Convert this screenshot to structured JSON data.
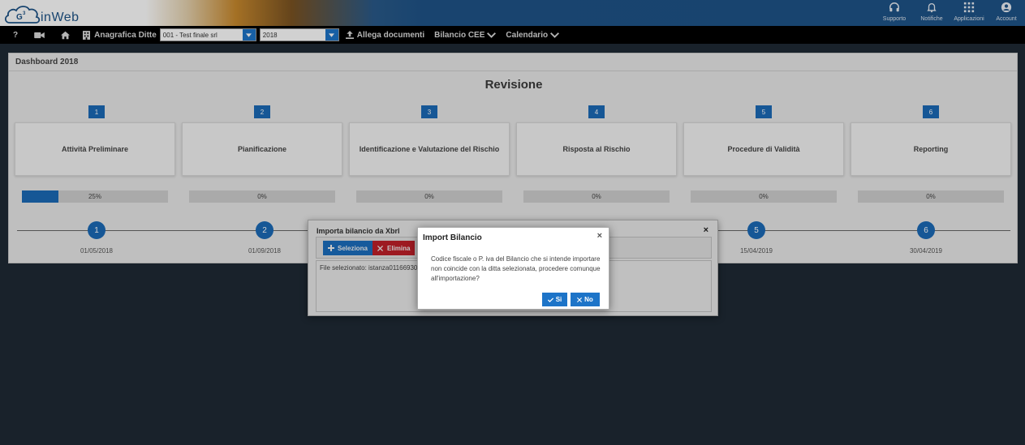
{
  "app": {
    "logo_badge": "G3",
    "logo_text": "inWeb"
  },
  "top_menu": [
    {
      "label": "Supporto",
      "icon": "headphones-icon"
    },
    {
      "label": "Notifiche",
      "icon": "bell-icon"
    },
    {
      "label": "Applicazioni",
      "icon": "grid-icon"
    },
    {
      "label": "Account",
      "icon": "user-icon"
    }
  ],
  "navbar": {
    "help": "?",
    "company_label": "Anagrafica Ditte",
    "company_value": "001 - Test finale srl",
    "year_value": "2018",
    "attach": "Allega documenti",
    "bilancio": "Bilancio CEE",
    "calendario": "Calendario"
  },
  "dashboard": {
    "header": "Dashboard 2018",
    "title": "Revisione",
    "steps": [
      {
        "num": "1",
        "label": "Attività Preliminare",
        "progress_text": "25%",
        "progress": 0.25,
        "node": "1",
        "date": "01/05/2018"
      },
      {
        "num": "2",
        "label": "Pianificazione",
        "progress_text": "0%",
        "progress": 0,
        "node": "2",
        "date": "01/09/2018"
      },
      {
        "num": "3",
        "label": "Identificazione e Valutazione del Rischio",
        "progress_text": "0%",
        "progress": 0,
        "node": "",
        "date": ""
      },
      {
        "num": "4",
        "label": "Risposta al Rischio",
        "progress_text": "0%",
        "progress": 0,
        "node": "",
        "date": ""
      },
      {
        "num": "5",
        "label": "Procedure di Validità",
        "progress_text": "0%",
        "progress": 0,
        "node": "5",
        "date": "15/04/2019"
      },
      {
        "num": "6",
        "label": "Reporting",
        "progress_text": "0%",
        "progress": 0,
        "node": "6",
        "date": "30/04/2019"
      }
    ]
  },
  "import_dialog": {
    "title": "Importa bilancio da Xbrl",
    "close": "×",
    "select_btn": "Seleziona",
    "delete_btn": "Elimina",
    "file_text": "File selezionato: istanza01166930519"
  },
  "confirm_dialog": {
    "title": "Import Bilancio",
    "close": "×",
    "message": "Codice fiscale o P. iva del Bilancio che si intende importare non coincide con la ditta selezionata, procedere comunque all'importazione?",
    "yes": "Si",
    "no": "No"
  },
  "colors": {
    "accent": "#1d74c8",
    "danger": "#c9202b",
    "nav_bg": "#000000",
    "header_blue": "#1e5488"
  }
}
